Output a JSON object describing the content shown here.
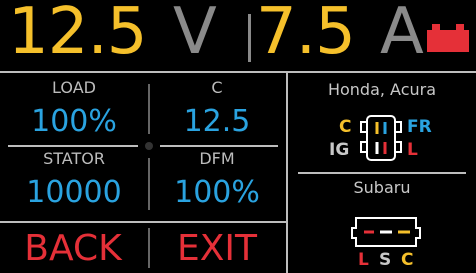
{
  "readout": {
    "voltage_value": "12.5",
    "voltage_unit": "V",
    "current_value": "7.5",
    "current_unit": "A",
    "battery_icon": "battery-icon"
  },
  "grid": {
    "load_label": "LOAD",
    "load_value": "100%",
    "c_label": "C",
    "c_value": "12.5",
    "stator_label": "STATOR",
    "stator_value": "10000",
    "dfm_label": "DFM",
    "dfm_value": "100%"
  },
  "buttons": {
    "back": "BACK",
    "exit": "EXIT"
  },
  "right": {
    "honda_title": "Honda, Acura",
    "honda_pins": {
      "c": "C",
      "fr": "FR",
      "ig": "IG",
      "l": "L"
    },
    "subaru_title": "Subaru",
    "subaru_pins": {
      "l": "L",
      "s": "S",
      "c": "C"
    }
  },
  "colors": {
    "yellow": "#f5c02b",
    "blue": "#2aa3e0",
    "red": "#e53038",
    "gray": "#8a8a8a"
  }
}
